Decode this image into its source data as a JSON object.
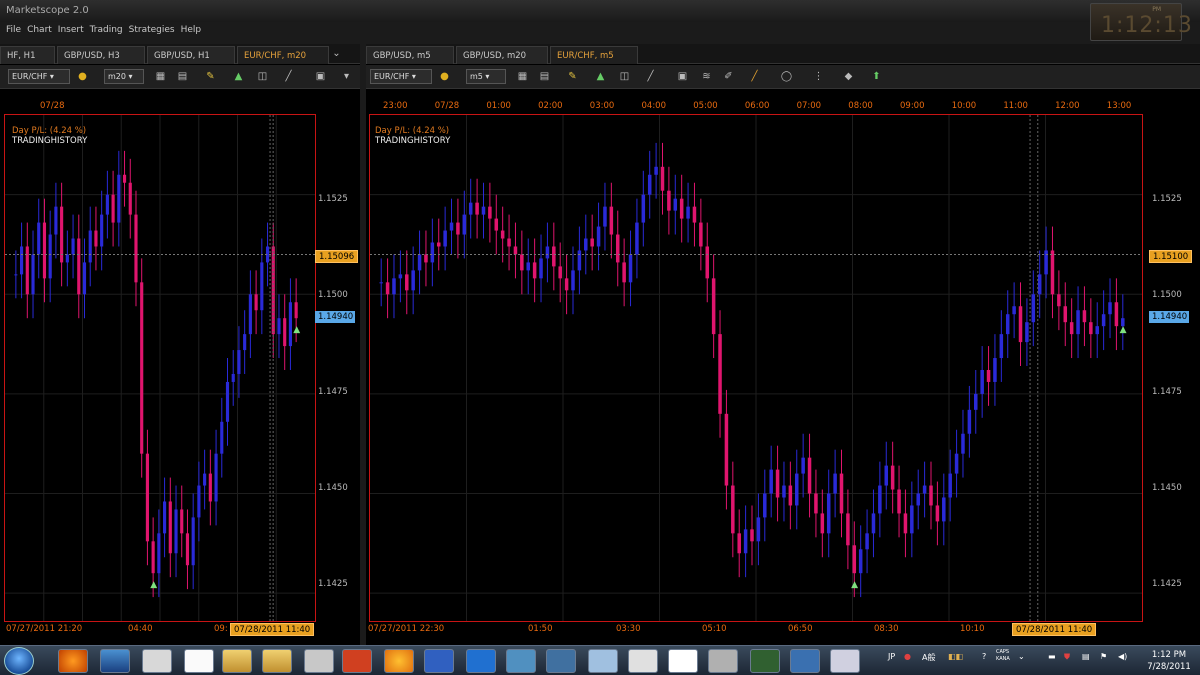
{
  "window": {
    "title": "Marketscope 2.0",
    "menu": [
      "File",
      "Chart",
      "Insert",
      "Trading",
      "Strategies",
      "Help"
    ]
  },
  "clock": {
    "pm": "PM",
    "time": "1:12:13"
  },
  "left": {
    "tabs": [
      {
        "label": "HF, H1"
      },
      {
        "label": "GBP/USD, H3"
      },
      {
        "label": "GBP/USD, H1"
      },
      {
        "label": "EUR/CHF, m20",
        "active": true
      }
    ],
    "toolbar": {
      "symbol": "EUR/CHF",
      "timeframe": "m20"
    },
    "top_times": [
      "07/28"
    ],
    "pl": "Day P/L: (4.24 %)",
    "history": "TRADINGHISTORY",
    "prices": [
      "1.1525",
      "1.1500",
      "1.1475",
      "1.1450",
      "1.1425"
    ],
    "cur_price": "1.15096",
    "bid": "1.14940",
    "bottom_times": [
      "07/27/2011 21:20",
      "04:40",
      "09:"
    ],
    "bottom_current": "07/28/2011 11:40"
  },
  "right": {
    "tabs": [
      {
        "label": "GBP/USD, m5"
      },
      {
        "label": "GBP/USD, m20"
      },
      {
        "label": "EUR/CHF, m5",
        "active": true
      }
    ],
    "toolbar": {
      "symbol": "EUR/CHF",
      "timeframe": "m5"
    },
    "top_times": [
      "23:00",
      "07/28",
      "01:00",
      "02:00",
      "03:00",
      "04:00",
      "05:00",
      "06:00",
      "07:00",
      "08:00",
      "09:00",
      "10:00",
      "11:00",
      "12:00",
      "13:00"
    ],
    "pl": "Day P/L: (4.24 %)",
    "history": "TRADINGHISTORY",
    "prices": [
      "1.1525",
      "1.1500",
      "1.1475",
      "1.1450",
      "1.1425"
    ],
    "cur_price": "1.15100",
    "bid": "1.14940",
    "bottom_times": [
      "07/27/2011 22:30",
      "01:50",
      "03:30",
      "05:10",
      "06:50",
      "08:30",
      "10:10"
    ],
    "bottom_current": "07/28/2011 11:40"
  },
  "chart_data": [
    {
      "type": "candlestick",
      "symbol": "EUR/CHF",
      "timeframe": "m20",
      "ylim": [
        1.1418,
        1.1545
      ],
      "series": [
        {
          "name": "",
          "values": [
            1.1505,
            1.1512,
            1.15,
            1.151,
            1.1518,
            1.1504,
            1.1515,
            1.1522,
            1.1508,
            1.151,
            1.1514,
            1.15,
            1.1508,
            1.1516,
            1.1512,
            1.152,
            1.1525,
            1.1518,
            1.153,
            1.1528,
            1.152,
            1.1503,
            1.146,
            1.1438,
            1.143,
            1.144,
            1.1448,
            1.1435,
            1.1446,
            1.144,
            1.1432,
            1.1444,
            1.1452,
            1.1455,
            1.1448,
            1.146,
            1.1468,
            1.1478,
            1.148,
            1.1486,
            1.149,
            1.15,
            1.1496,
            1.1508,
            1.1512,
            1.149,
            1.1494,
            1.1487,
            1.1498,
            1.1494
          ]
        }
      ]
    },
    {
      "type": "candlestick",
      "symbol": "EUR/CHF",
      "timeframe": "m5",
      "ylim": [
        1.1418,
        1.1545
      ],
      "series": [
        {
          "name": "",
          "values": [
            1.1503,
            1.15,
            1.1504,
            1.1505,
            1.1501,
            1.1506,
            1.151,
            1.1508,
            1.1513,
            1.1512,
            1.1516,
            1.1518,
            1.1515,
            1.152,
            1.1523,
            1.152,
            1.1522,
            1.1519,
            1.1516,
            1.1514,
            1.1512,
            1.151,
            1.1506,
            1.1508,
            1.1504,
            1.1509,
            1.1512,
            1.1507,
            1.1504,
            1.1501,
            1.1506,
            1.1511,
            1.1514,
            1.1512,
            1.1517,
            1.1522,
            1.1515,
            1.1508,
            1.1503,
            1.151,
            1.1518,
            1.1525,
            1.153,
            1.1532,
            1.1526,
            1.1521,
            1.1524,
            1.1519,
            1.1522,
            1.1518,
            1.1512,
            1.1504,
            1.149,
            1.147,
            1.1452,
            1.144,
            1.1435,
            1.1441,
            1.1438,
            1.1444,
            1.145,
            1.1456,
            1.1449,
            1.1452,
            1.1447,
            1.1455,
            1.1459,
            1.145,
            1.1445,
            1.144,
            1.145,
            1.1455,
            1.1445,
            1.1437,
            1.143,
            1.1436,
            1.144,
            1.1445,
            1.1452,
            1.1457,
            1.1451,
            1.1445,
            1.144,
            1.1447,
            1.145,
            1.1452,
            1.1447,
            1.1443,
            1.1449,
            1.1455,
            1.146,
            1.1465,
            1.1471,
            1.1475,
            1.1481,
            1.1478,
            1.1484,
            1.149,
            1.1495,
            1.1497,
            1.1488,
            1.1493,
            1.15,
            1.1505,
            1.1511,
            1.15,
            1.1497,
            1.1493,
            1.149,
            1.1496,
            1.1493,
            1.149,
            1.1492,
            1.1495,
            1.1498,
            1.1492,
            1.1494
          ]
        }
      ]
    }
  ],
  "taskbar": {
    "tray_lang": "JP",
    "tray_caps": "CAPS KANA",
    "time": "1:12 PM",
    "date": "7/28/2011"
  }
}
